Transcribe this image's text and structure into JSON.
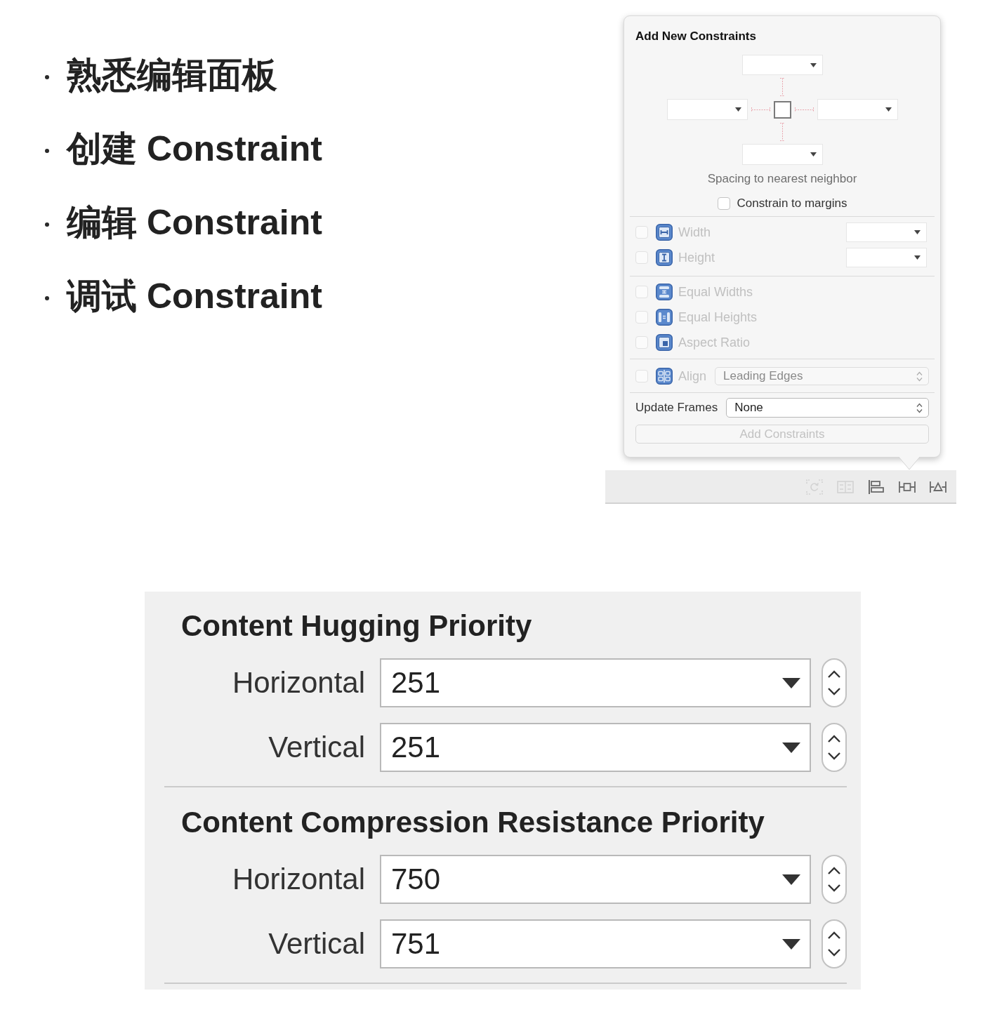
{
  "slide_bullets": [
    "熟悉编辑面板",
    "创建 Constraint",
    "编辑 Constraint",
    "调试 Constraint"
  ],
  "constraints_popover": {
    "title": "Add New Constraints",
    "spacing_pins": [
      {
        "on": false
      },
      {
        "on": false
      },
      {
        "on": false
      },
      {
        "on": false
      }
    ],
    "spacing_caption": "Spacing to nearest neighbor",
    "constrain_to_margins": {
      "label": "Constrain to margins",
      "checked": false
    },
    "size_constraints": [
      {
        "label": "Width",
        "checked": false,
        "disabled": true
      },
      {
        "label": "Height",
        "checked": false,
        "disabled": true
      }
    ],
    "equal_constraints": [
      {
        "label": "Equal Widths",
        "checked": false,
        "disabled": true
      },
      {
        "label": "Equal Heights",
        "checked": false,
        "disabled": true
      },
      {
        "label": "Aspect Ratio",
        "checked": false,
        "disabled": true
      }
    ],
    "align": {
      "label": "Align",
      "checked": false,
      "disabled": true,
      "value": "Leading Edges"
    },
    "update_frames": {
      "label": "Update Frames",
      "value": "None"
    },
    "add_button": {
      "label": "Add Constraints",
      "disabled": true
    }
  },
  "toolbar": [
    {
      "disabled": true
    },
    {
      "disabled": true
    },
    {
      "disabled": false
    },
    {
      "disabled": false
    },
    {
      "disabled": false
    }
  ],
  "priority_panel": {
    "sections": [
      {
        "title": "Content Hugging Priority",
        "rows": [
          {
            "label": "Horizontal",
            "value": "251"
          },
          {
            "label": "Vertical",
            "value": "251"
          }
        ]
      },
      {
        "title": "Content Compression Resistance Priority",
        "rows": [
          {
            "label": "Horizontal",
            "value": "750"
          },
          {
            "label": "Vertical",
            "value": "751"
          }
        ]
      }
    ]
  }
}
